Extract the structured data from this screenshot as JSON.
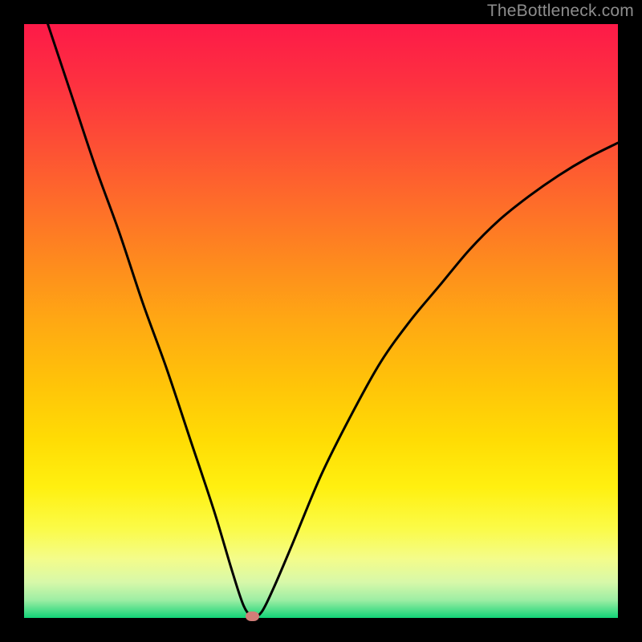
{
  "watermark": "TheBottleneck.com",
  "colors": {
    "frame_border": "#000000",
    "curve": "#000000",
    "marker": "#d17d78",
    "gradient_stops": [
      {
        "offset": 0.0,
        "color": "#fd1a48"
      },
      {
        "offset": 0.1,
        "color": "#fd3140"
      },
      {
        "offset": 0.2,
        "color": "#fd4e35"
      },
      {
        "offset": 0.3,
        "color": "#fe6c2a"
      },
      {
        "offset": 0.4,
        "color": "#fe8a1e"
      },
      {
        "offset": 0.5,
        "color": "#ffa813"
      },
      {
        "offset": 0.6,
        "color": "#ffc209"
      },
      {
        "offset": 0.7,
        "color": "#ffdc04"
      },
      {
        "offset": 0.78,
        "color": "#fff010"
      },
      {
        "offset": 0.85,
        "color": "#fbfb48"
      },
      {
        "offset": 0.9,
        "color": "#f4fc8a"
      },
      {
        "offset": 0.94,
        "color": "#d7f8a9"
      },
      {
        "offset": 0.97,
        "color": "#9deea4"
      },
      {
        "offset": 1.0,
        "color": "#12d377"
      }
    ]
  },
  "chart_data": {
    "type": "line",
    "title": "",
    "xlabel": "",
    "ylabel": "",
    "xlim": [
      0,
      100
    ],
    "ylim": [
      0,
      100
    ],
    "series": [
      {
        "name": "bottleneck-curve",
        "x": [
          4,
          8,
          12,
          16,
          20,
          24,
          28,
          32,
          35,
          37,
          38.5,
          40,
          42,
          45,
          50,
          55,
          60,
          65,
          70,
          75,
          80,
          85,
          90,
          95,
          100
        ],
        "y": [
          100,
          88,
          76,
          65,
          53,
          42,
          30,
          18,
          8,
          2,
          0.3,
          1,
          5,
          12,
          24,
          34,
          43,
          50,
          56,
          62,
          67,
          71,
          74.5,
          77.5,
          80
        ]
      }
    ],
    "marker": {
      "x": 38.5,
      "y": 0.3,
      "color": "#d17d78"
    },
    "background": {
      "direction": "vertical",
      "stops_comment": "y=0 is green (bottom), y=100 is red (top)",
      "stops": [
        {
          "y": 100,
          "color": "#fd1a48"
        },
        {
          "y": 90,
          "color": "#fd3140"
        },
        {
          "y": 80,
          "color": "#fd4e35"
        },
        {
          "y": 70,
          "color": "#fe6c2a"
        },
        {
          "y": 60,
          "color": "#fe8a1e"
        },
        {
          "y": 50,
          "color": "#ffa813"
        },
        {
          "y": 40,
          "color": "#ffc209"
        },
        {
          "y": 30,
          "color": "#ffdc04"
        },
        {
          "y": 22,
          "color": "#fff010"
        },
        {
          "y": 15,
          "color": "#fbfb48"
        },
        {
          "y": 10,
          "color": "#f4fc8a"
        },
        {
          "y": 6,
          "color": "#d7f8a9"
        },
        {
          "y": 3,
          "color": "#9deea4"
        },
        {
          "y": 0,
          "color": "#12d377"
        }
      ]
    }
  }
}
